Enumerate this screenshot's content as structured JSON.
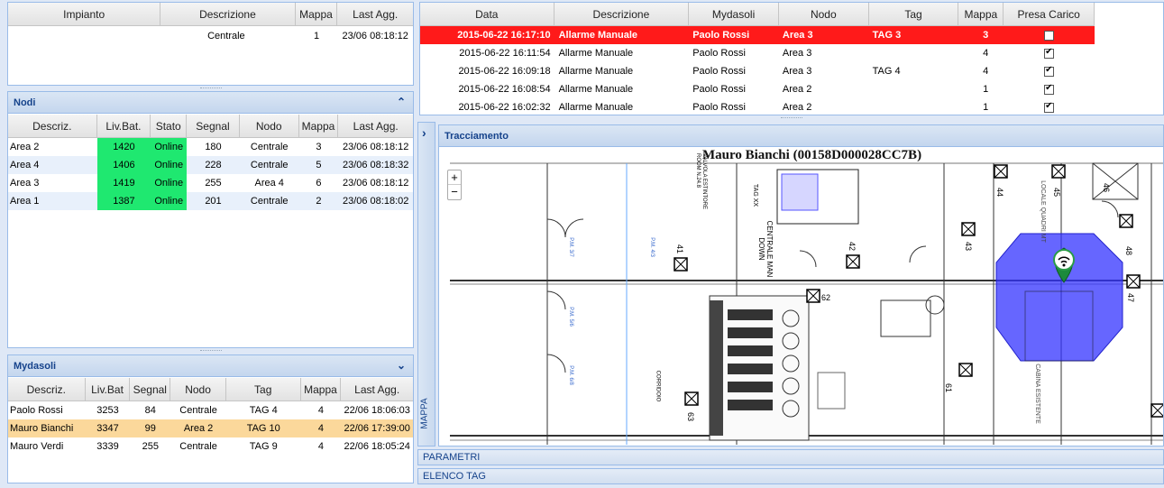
{
  "impianto": {
    "columns": [
      "Impianto",
      "Descrizione",
      "Mappa",
      "Last Agg."
    ],
    "rows": [
      {
        "impianto": "",
        "descrizione": "Centrale",
        "mappa": "1",
        "last": "23/06 08:18:12"
      }
    ]
  },
  "nodi": {
    "title": "Nodi",
    "columns": [
      "Descriz.",
      "Liv.Bat.",
      "Stato",
      "Segnal",
      "Nodo",
      "Mappa",
      "Last Agg."
    ],
    "rows": [
      {
        "descr": "Area 2",
        "bat": "1420",
        "stato": "Online",
        "segnal": "180",
        "nodo": "Centrale",
        "mappa": "3",
        "last": "23/06 08:18:12"
      },
      {
        "descr": "Area 4",
        "bat": "1406",
        "stato": "Online",
        "segnal": "228",
        "nodo": "Centrale",
        "mappa": "5",
        "last": "23/06 08:18:32"
      },
      {
        "descr": "Area 3",
        "bat": "1419",
        "stato": "Online",
        "segnal": "255",
        "nodo": "Area 4",
        "mappa": "6",
        "last": "23/06 08:18:12"
      },
      {
        "descr": "Area 1",
        "bat": "1387",
        "stato": "Online",
        "segnal": "201",
        "nodo": "Centrale",
        "mappa": "2",
        "last": "23/06 08:18:02"
      }
    ]
  },
  "mydasoli": {
    "title": "Mydasoli",
    "columns": [
      "Descriz.",
      "Liv.Bat",
      "Segnal",
      "Nodo",
      "Tag",
      "Mappa",
      "Last Agg."
    ],
    "rows": [
      {
        "descr": "Paolo Rossi",
        "bat": "3253",
        "segnal": "84",
        "nodo": "Centrale",
        "tag": "TAG 4",
        "mappa": "4",
        "last": "22/06 18:06:03"
      },
      {
        "descr": "Mauro Bianchi",
        "bat": "3347",
        "segnal": "99",
        "nodo": "Area 2",
        "tag": "TAG 10",
        "mappa": "4",
        "last": "22/06 17:39:00"
      },
      {
        "descr": "Mauro Verdi",
        "bat": "3339",
        "segnal": "255",
        "nodo": "Centrale",
        "tag": "TAG 9",
        "mappa": "4",
        "last": "22/06 18:05:24"
      }
    ]
  },
  "allarmi": {
    "columns": [
      "Data",
      "Descrizione",
      "Mydasoli",
      "Nodo",
      "Tag",
      "Mappa",
      "Presa Carico"
    ],
    "rows": [
      {
        "data": "2015-06-22 16:17:10",
        "descr": "Allarme Manuale",
        "myda": "Paolo Rossi",
        "nodo": "Area 3",
        "tag": "TAG 3",
        "mappa": "3",
        "presa": false
      },
      {
        "data": "2015-06-22 16:11:54",
        "descr": "Allarme Manuale",
        "myda": "Paolo Rossi",
        "nodo": "Area 3",
        "tag": "",
        "mappa": "4",
        "presa": true
      },
      {
        "data": "2015-06-22 16:09:18",
        "descr": "Allarme Manuale",
        "myda": "Paolo Rossi",
        "nodo": "Area 3",
        "tag": "TAG 4",
        "mappa": "4",
        "presa": true
      },
      {
        "data": "2015-06-22 16:08:54",
        "descr": "Allarme Manuale",
        "myda": "Paolo Rossi",
        "nodo": "Area 2",
        "tag": "",
        "mappa": "1",
        "presa": true
      },
      {
        "data": "2015-06-22 16:02:32",
        "descr": "Allarme Manuale",
        "myda": "Paolo Rossi",
        "nodo": "Area 2",
        "tag": "",
        "mappa": "1",
        "presa": true
      }
    ]
  },
  "tracciamento": {
    "title": "Tracciamento",
    "map_title": "Mauro Bianchi (00158D000028CC7B)",
    "zoom_in": "+",
    "zoom_out": "−",
    "collapse_arrow": "›",
    "mappa_vertical": "MAPPA",
    "room_numbers": [
      "44",
      "45",
      "41",
      "42",
      "43",
      "47",
      "62",
      "61",
      "63",
      "46",
      "48"
    ],
    "plan_labels": [
      "CENTRALE MAN DOWN",
      "LOCALE QUADRI MT",
      "CABINA ESISTENTE",
      "TAG XX",
      "VALVOLA ESTINTORE ROOM N.24.8",
      "CORRIDOIO",
      "P.M. 3/7",
      "P.M. 5/6",
      "P.M. 6/8",
      "P.M. 4/3"
    ]
  },
  "bottom_bars": {
    "parametri": "PARAMETRI",
    "elenco_tag": "ELENCO TAG"
  },
  "colors": {
    "alarm_row": "#ff1a1a",
    "online": "#1fe870",
    "selected_row": "#fbd89b",
    "zone": "#3333ff"
  }
}
